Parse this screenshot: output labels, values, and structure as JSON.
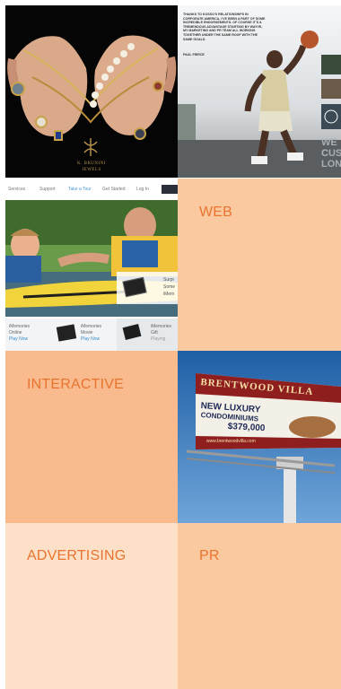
{
  "tiles": {
    "jewelry": {
      "brand_line1": "K. BRUNINI",
      "brand_line2": "JEWELS"
    },
    "athlete": {
      "quote": "THANKS TO KOSSO'S RELATIONSHIPS IN CORPORATE AMERICA, I'VE BEEN A PART OF SOME INCREDIBLE ENDORSEMENTS. OF COURSE IT'S A TREMENDOUS ADVANTAGE STARTING BY WAYVE, MY MARKETING AND PR TEAM ALL WORKING TOGETHER UNDER THE SAME ROOF WITH THE SAME GOALS.",
      "quote_author": "PAUL PIERCE",
      "side_text": [
        "WE C",
        "CUST",
        "LONG"
      ]
    },
    "website": {
      "nav": [
        "Services",
        "Support",
        "Take a Tour",
        "Get Started",
        "Log In"
      ],
      "promo_text": [
        "Surpr",
        "Some",
        "iMem"
      ],
      "products": [
        {
          "name": "iMemories",
          "sub": "Online",
          "action": "Play Now"
        },
        {
          "name": "iMemories",
          "sub": "Movie",
          "action": "Play Now"
        },
        {
          "name": "iMemories",
          "sub": "Gift",
          "action": "Playing"
        }
      ]
    },
    "web": {
      "label": "WEB"
    },
    "interactive": {
      "label": "INTERACTIVE"
    },
    "billboard": {
      "brand": "BRENTWOOD VILLA",
      "line1": "NEW LUXURY",
      "line2": "CONDOMINIUMS",
      "price": "$379,000",
      "url": "www.brentwoodvilla.com"
    },
    "advertising": {
      "label": "ADVERTISING"
    },
    "pr": {
      "label": "PR"
    }
  },
  "colors": {
    "label_orange": "#e8742f",
    "peach": "#fbc9a0",
    "peach_dark": "#f9bb8e",
    "peach_light": "#fde0c8"
  }
}
